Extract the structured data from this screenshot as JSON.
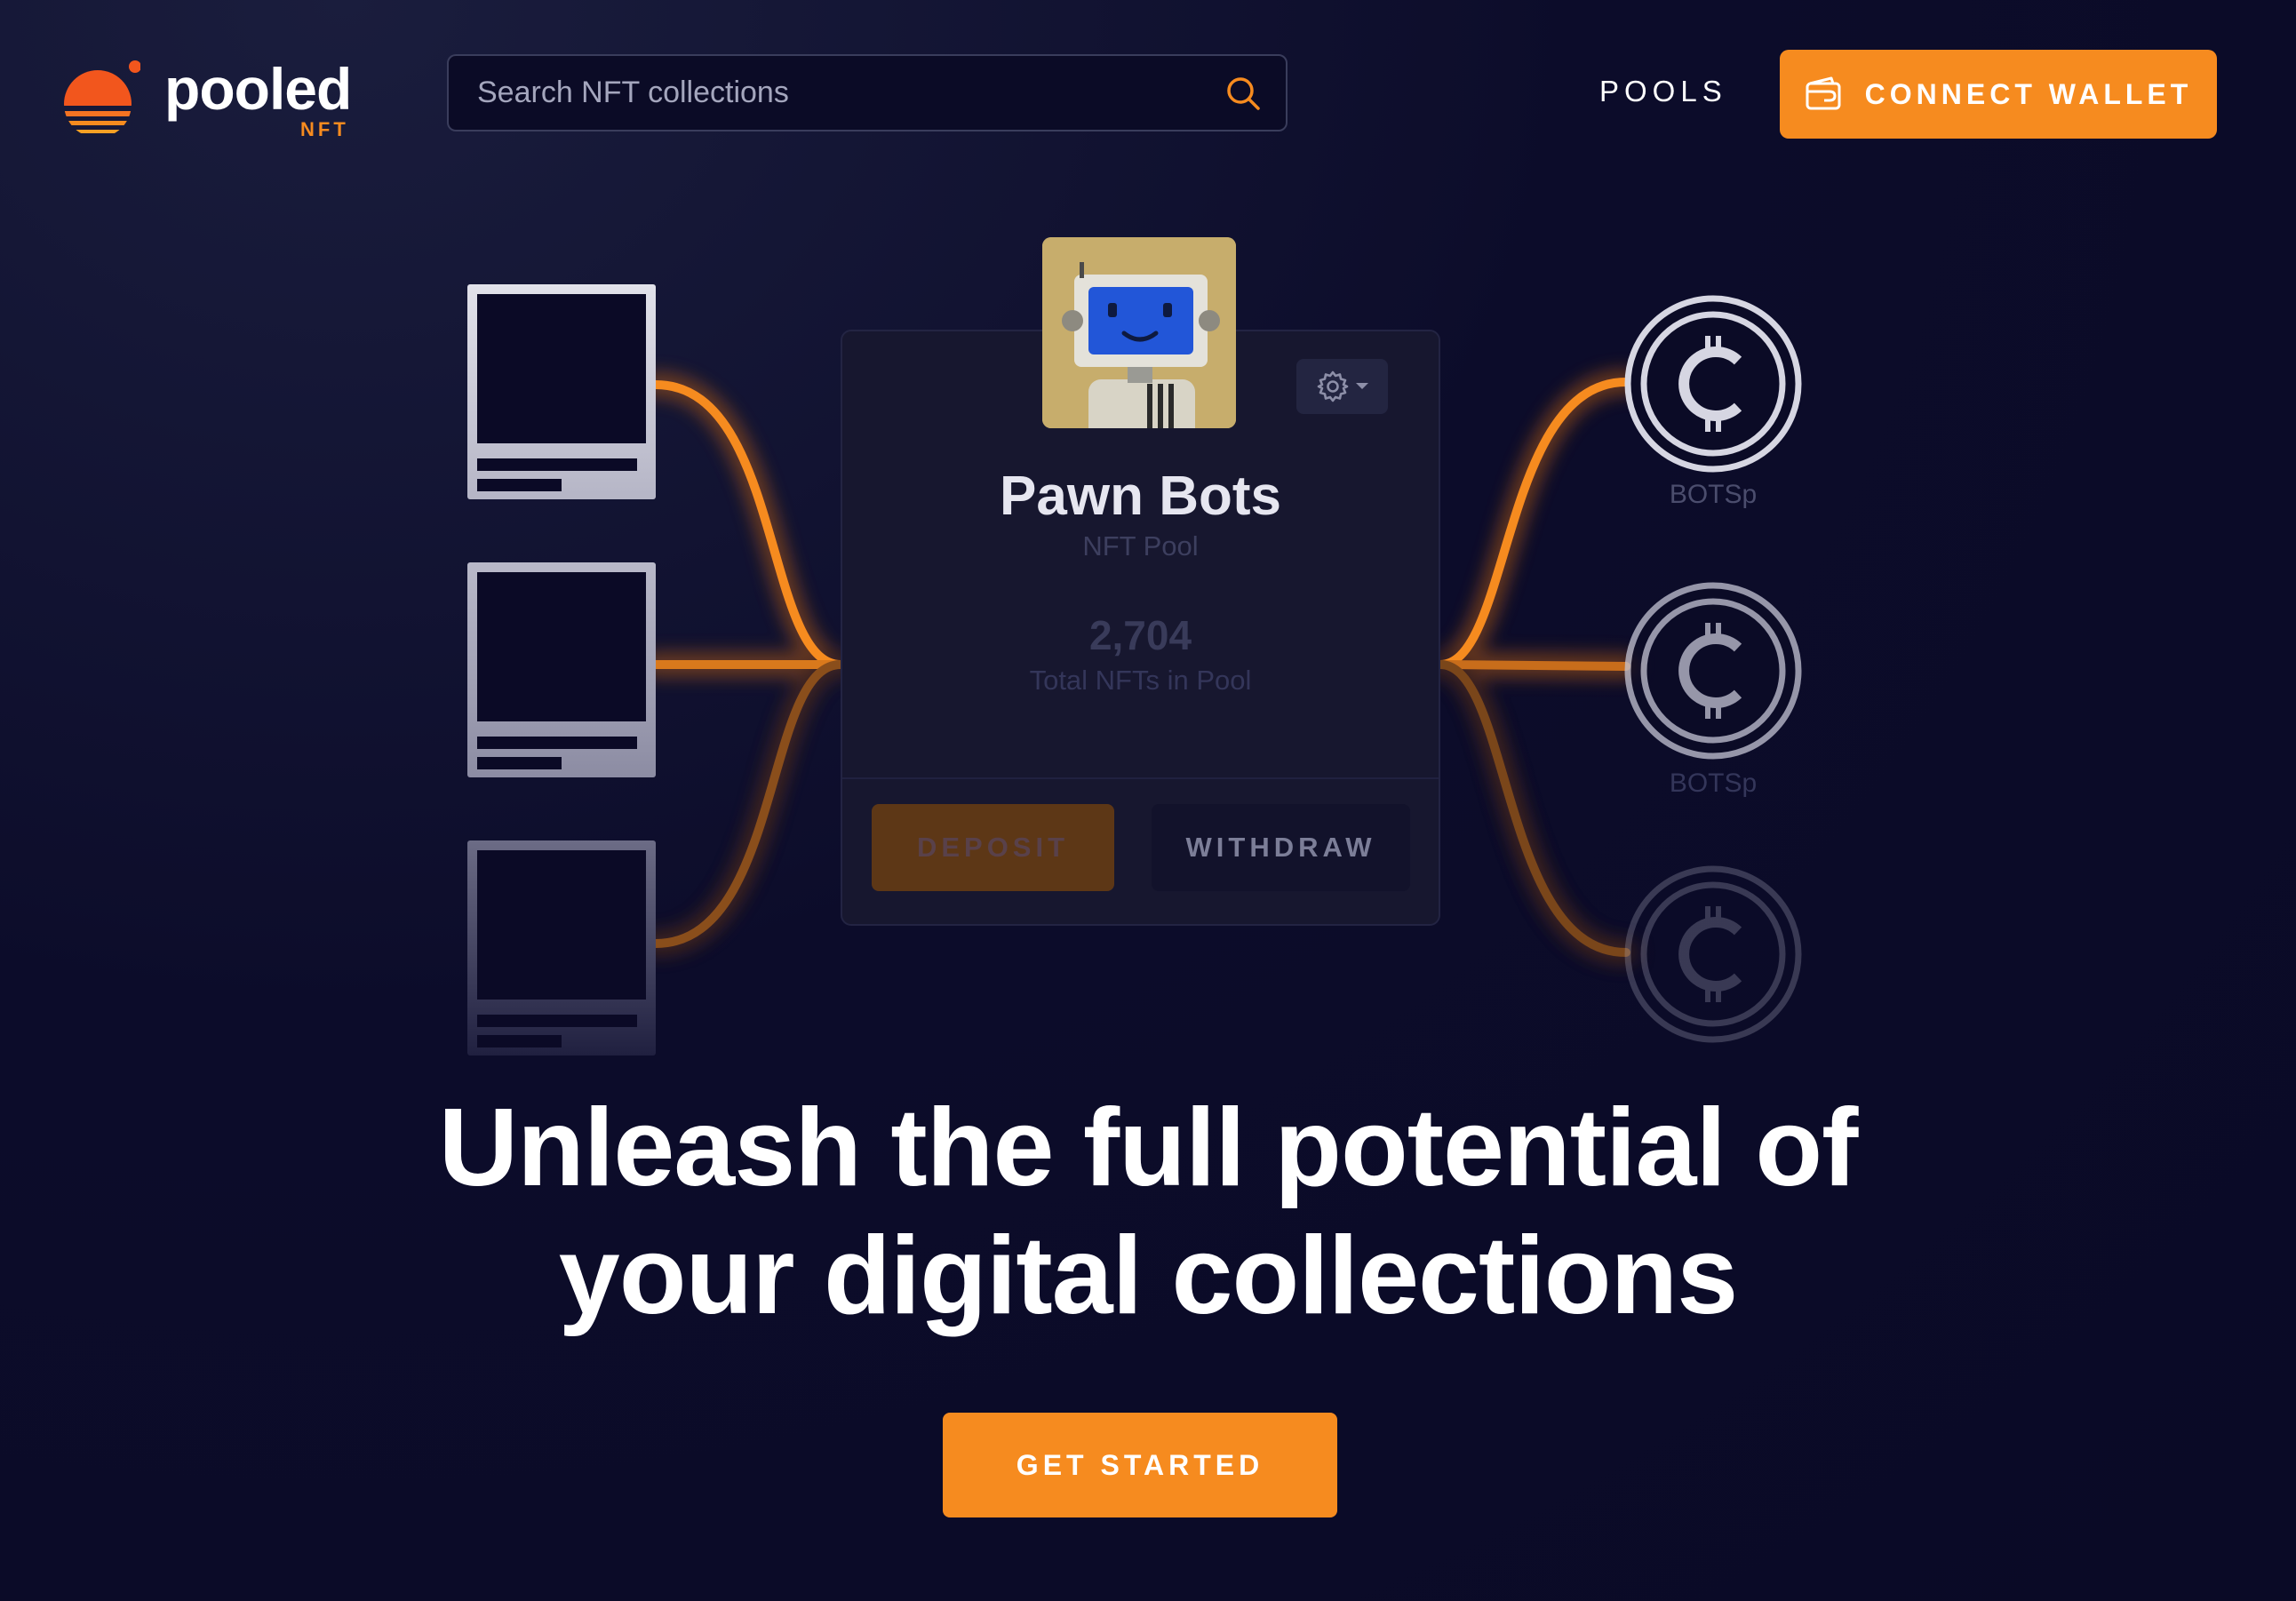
{
  "brand": {
    "name": "pooled",
    "sub": "NFT"
  },
  "search": {
    "placeholder": "Search NFT collections"
  },
  "nav": {
    "pools_label": "POOLS"
  },
  "wallet": {
    "connect_label": "CONNECT WALLET"
  },
  "colors": {
    "accent": "#f68b1f",
    "background": "#0c0c2a",
    "card": "#17172f"
  },
  "pool_card": {
    "title": "Pawn Bots",
    "subtitle": "NFT Pool",
    "count": "2,704",
    "count_label": "Total NFTs in Pool",
    "deposit_label": "DEPOSIT",
    "withdraw_label": "WITHDRAW"
  },
  "tokens": [
    {
      "label": "BOTSp",
      "icon": "cent-coin-icon"
    },
    {
      "label": "BOTSp",
      "icon": "cent-coin-icon"
    },
    {
      "label": "",
      "icon": "cent-coin-icon"
    }
  ],
  "hero": {
    "line1": "Unleash the full potential of",
    "line2": "your digital collections",
    "cta_label": "GET STARTED"
  }
}
